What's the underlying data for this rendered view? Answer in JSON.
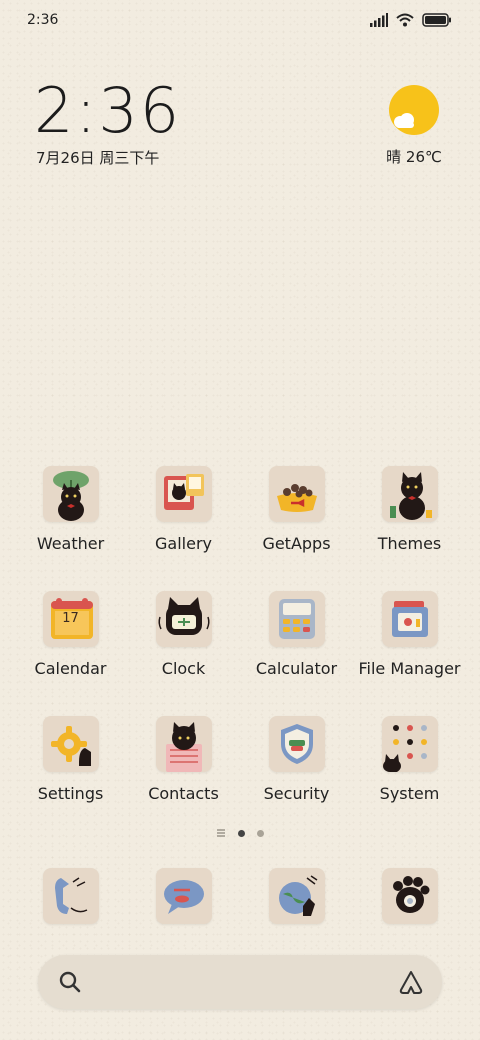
{
  "status_bar": {
    "time": "2:36"
  },
  "clock": {
    "time": "2:36",
    "date": "7月26日 周三下午"
  },
  "weather": {
    "text": "晴 26℃",
    "icon": "sun-cloud-icon"
  },
  "apps": [
    {
      "label": "Weather",
      "icon": "weather-icon"
    },
    {
      "label": "Gallery",
      "icon": "gallery-icon"
    },
    {
      "label": "GetApps",
      "icon": "getapps-icon"
    },
    {
      "label": "Themes",
      "icon": "themes-icon"
    },
    {
      "label": "Calendar",
      "icon": "calendar-icon",
      "badge": "17"
    },
    {
      "label": "Clock",
      "icon": "clock-icon"
    },
    {
      "label": "Calculator",
      "icon": "calculator-icon"
    },
    {
      "label": "File Manager",
      "icon": "file-manager-icon"
    },
    {
      "label": "Settings",
      "icon": "settings-icon"
    },
    {
      "label": "Contacts",
      "icon": "contacts-icon"
    },
    {
      "label": "Security",
      "icon": "security-icon"
    },
    {
      "label": "System",
      "icon": "system-folder-icon"
    }
  ],
  "dock": [
    {
      "icon": "phone-icon"
    },
    {
      "icon": "messages-icon"
    },
    {
      "icon": "browser-icon"
    },
    {
      "icon": "camera-icon"
    }
  ],
  "colors": {
    "background": "#f2ece0",
    "tile": "#e6d8c8",
    "accent_sun": "#f7c21a"
  }
}
